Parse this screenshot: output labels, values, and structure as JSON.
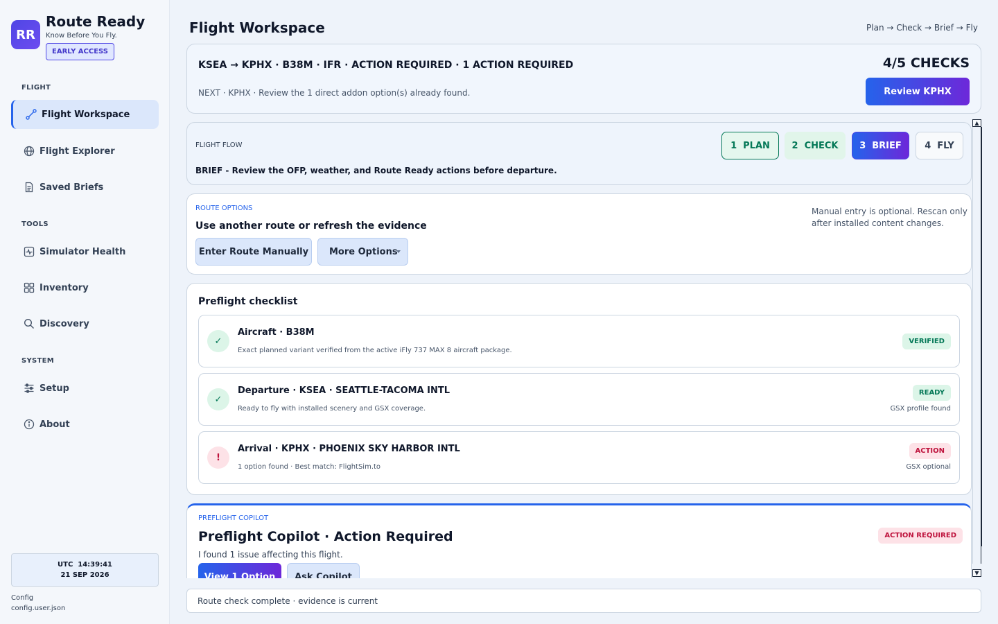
{
  "app": {
    "logo_text": "RR",
    "name": "Route Ready",
    "tagline": "Know Before You Fly.",
    "badge": "EARLY ACCESS"
  },
  "sidebar": {
    "sections": [
      {
        "label": "FLIGHT",
        "items": [
          {
            "label": "Flight Workspace",
            "icon": "route-icon",
            "active": true
          },
          {
            "label": "Flight Explorer",
            "icon": "globe-icon"
          },
          {
            "label": "Saved Briefs",
            "icon": "document-icon"
          }
        ]
      },
      {
        "label": "TOOLS",
        "items": [
          {
            "label": "Simulator Health",
            "icon": "pulse-icon"
          },
          {
            "label": "Inventory",
            "icon": "grid-icon"
          },
          {
            "label": "Discovery",
            "icon": "search-icon"
          }
        ]
      },
      {
        "label": "SYSTEM",
        "items": [
          {
            "label": "Setup",
            "icon": "sliders-icon"
          },
          {
            "label": "About",
            "icon": "info-icon"
          }
        ]
      }
    ],
    "clock": {
      "time": "UTC  14:39:41",
      "date": "21 SEP 2026"
    },
    "config": {
      "label": "Config",
      "file": "config.user.json"
    }
  },
  "header": {
    "title": "Flight Workspace",
    "steps": "Plan → Check → Brief → Fly"
  },
  "summary": {
    "line": "KSEA → KPHX · B38M · IFR · ACTION REQUIRED · 1 ACTION REQUIRED",
    "next": "NEXT · KPHX · Review the 1 direct addon option(s) already found.",
    "checks": "4/5 CHECKS",
    "button": "Review KPHX"
  },
  "flow": {
    "label": "FLIGHT FLOW",
    "description": "BRIEF - Review the OFP, weather, and Route Ready actions before departure.",
    "steps": [
      {
        "num": "1",
        "label": "PLAN",
        "state": "done"
      },
      {
        "num": "2",
        "label": "CHECK",
        "state": "done"
      },
      {
        "num": "3",
        "label": "BRIEF",
        "state": "current"
      },
      {
        "num": "4",
        "label": "FLY",
        "state": "pending"
      }
    ]
  },
  "route_options": {
    "label": "ROUTE OPTIONS",
    "title": "Use another route or refresh the evidence",
    "note": "Manual entry is optional. Rescan only after installed content changes.",
    "manual_button": "Enter Route Manually",
    "more_button": "More Options"
  },
  "checklist": {
    "title": "Preflight checklist",
    "items": [
      {
        "name": "Aircraft · B38M",
        "description": "Exact planned variant verified from the active iFly 737 MAX 8 aircraft package.",
        "status": "VERIFIED",
        "sub": "",
        "state": "ok"
      },
      {
        "name": "Departure · KSEA · SEATTLE-TACOMA INTL",
        "description": "Ready to fly with installed scenery and GSX coverage.",
        "status": "READY",
        "sub": "GSX profile found",
        "state": "ok"
      },
      {
        "name": "Arrival · KPHX · PHOENIX SKY HARBOR INTL",
        "description": "1 option found · Best match: FlightSim.to",
        "status": "ACTION",
        "sub": "GSX optional",
        "state": "action"
      }
    ]
  },
  "copilot": {
    "label": "PREFLIGHT COPILOT",
    "title": "Preflight Copilot · Action Required",
    "text": "I found 1 issue affecting this flight.",
    "status": "ACTION REQUIRED",
    "view_button": "View 1 Option",
    "ask_button": "Ask Copilot"
  },
  "statusbar": {
    "text": "Route check complete · evidence is current"
  },
  "colors": {
    "accent": "#2563eb",
    "accent_purple": "#6d28d9",
    "success": "#047857",
    "danger": "#be123c"
  }
}
